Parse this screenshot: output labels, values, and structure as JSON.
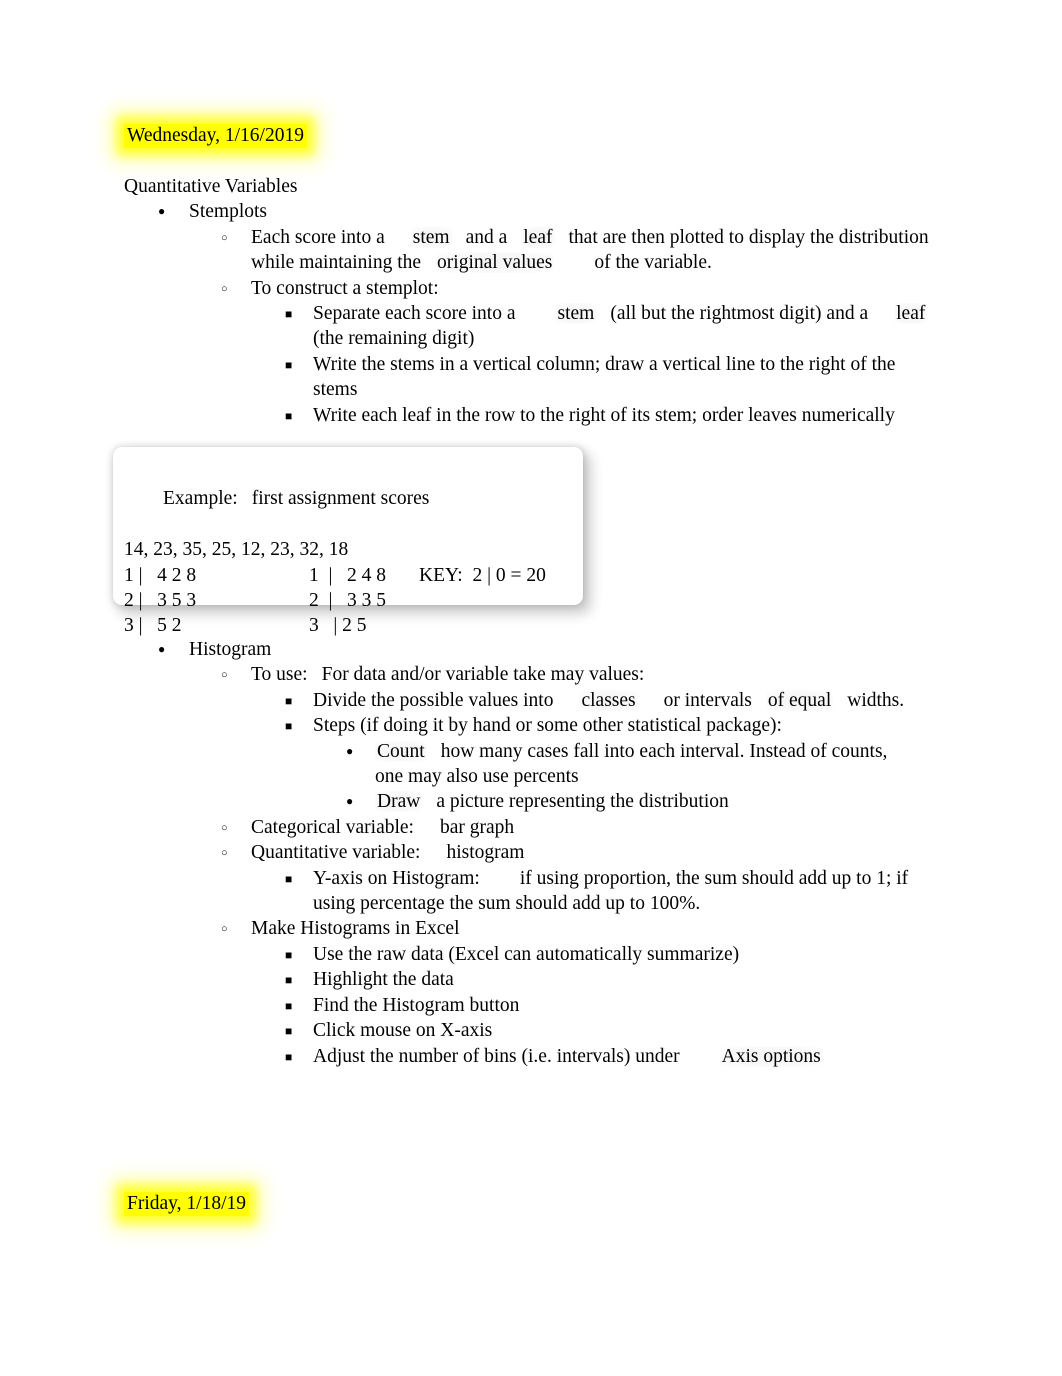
{
  "document": {
    "background_color": "#ffffff",
    "text_color": "#000000",
    "highlight_color": "#ffff00"
  },
  "dates": {
    "top": "Wednesday, 1/16/2019",
    "bottom": "Friday, 1/18/19"
  },
  "heading": "Quantitative Variables",
  "stemplots": {
    "title": "Stemplots",
    "definition_part1": "Each score into a",
    "definition_stem": "stem",
    "definition_part2": "and a",
    "definition_leaf": "leaf",
    "definition_part3": "that are then plotted to display the distribution",
    "definition_line2_pre": "while maintaining the",
    "definition_original_values": "original values",
    "definition_line2_post": "of the variable.",
    "construct_label": "To construct a stemplot:",
    "step1_pre": "Separate each score into a",
    "step1_stem": "stem",
    "step1_mid": "(all but the rightmost digit) and a",
    "step1_leaf": "leaf",
    "step1_line2": "(the remaining digit)",
    "step2_line1": "Write the stems in a vertical column; draw a vertical line to the right of the",
    "step2_line2": "stems",
    "step3": "Write each leaf in the row to the right of its stem; order leaves numerically"
  },
  "example_box": {
    "label": "Example:",
    "caption": "first assignment scores",
    "data_values": "14, 23, 35, 25, 12, 23, 32, 18",
    "unordered_rows": [
      "1 |   4 2 8",
      "2 |   3 5 3",
      "3 |   5 2"
    ],
    "ordered_rows": [
      "1  |   2 4 8",
      "2  |   3 3 5",
      "3   | 2 5"
    ],
    "key": "KEY:  2 | 0 = 20"
  },
  "histogram": {
    "title": "Histogram",
    "to_use_label": "To use:",
    "to_use_text": "For data and/or variable take may values:",
    "divide_pre": "Divide the possible values into",
    "divide_classes": "classes",
    "divide_mid": "or intervals",
    "divide_equal": "of equal",
    "divide_post": "widths.",
    "steps_label": "Steps (if doing it by hand or some other statistical package):",
    "count_word": "Count",
    "count_text": "how many cases fall into each interval. Instead of counts,",
    "count_line2": "one may also use percents",
    "draw_word": "Draw",
    "draw_text": "a picture representing the distribution",
    "categorical_label": "Categorical variable:",
    "categorical_value": "bar graph",
    "quantitative_label": "Quantitative variable:",
    "quantitative_value": "histogram",
    "yaxis_label": "Y-axis on Histogram:",
    "yaxis_line1": "if using proportion, the sum should add up to 1; if",
    "yaxis_line2": "using percentage the sum should add up to 100%.",
    "excel_title": "Make Histograms in Excel",
    "excel_steps": [
      "Use the raw data (Excel can automatically summarize)",
      "Highlight the data",
      "Find the Histogram button",
      "Click mouse on X-axis"
    ],
    "excel_last_pre": "Adjust the number of bins (i.e. intervals) under",
    "excel_last_post": "Axis options"
  }
}
